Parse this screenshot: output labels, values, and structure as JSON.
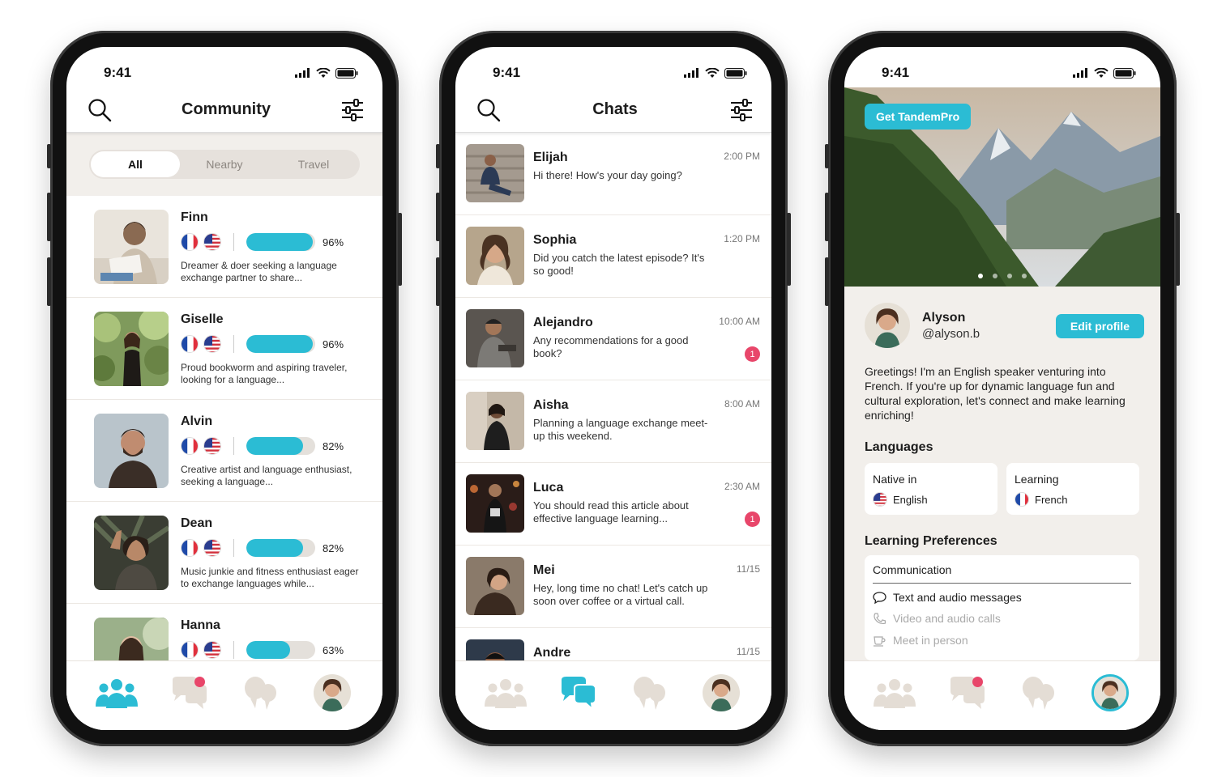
{
  "status": {
    "time": "9:41"
  },
  "community": {
    "title": "Community",
    "segments": [
      "All",
      "Nearby",
      "Travel"
    ],
    "members": [
      {
        "name": "Finn",
        "percent_label": "96%",
        "match": 0.96,
        "bio": "Dreamer & doer seeking a language exchange partner to share...",
        "photo": "man-reading-photo"
      },
      {
        "name": "Giselle",
        "percent_label": "96%",
        "match": 0.96,
        "bio": "Proud bookworm and aspiring traveler, looking for a language...",
        "photo": "woman-forest-photo"
      },
      {
        "name": "Alvin",
        "percent_label": "82%",
        "match": 0.82,
        "bio": "Creative artist and language enthusiast, seeking a language...",
        "photo": "man-beard-photo"
      },
      {
        "name": "Dean",
        "percent_label": "82%",
        "match": 0.82,
        "bio": "Music junkie and fitness enthusiast eager to exchange languages while...",
        "photo": "man-palm-photo"
      },
      {
        "name": "Hanna",
        "percent_label": "63%",
        "match": 0.63,
        "bio": "",
        "photo": "woman-park-photo"
      }
    ]
  },
  "chats": {
    "title": "Chats",
    "threads": [
      {
        "name": "Elijah",
        "time": "2:00 PM",
        "message": "Hi there! How's your day going?",
        "unread": ""
      },
      {
        "name": "Sophia",
        "time": "1:20 PM",
        "message": "Did you catch the latest episode? It's so good!",
        "unread": ""
      },
      {
        "name": "Alejandro",
        "time": "10:00 AM",
        "message": "Any recommendations for a good book?",
        "unread": "1"
      },
      {
        "name": "Aisha",
        "time": "8:00 AM",
        "message": "Planning a language exchange meet-up this weekend.",
        "unread": ""
      },
      {
        "name": "Luca",
        "time": "2:30 AM",
        "message": "You should read this article about effective language learning...",
        "unread": "1"
      },
      {
        "name": "Mei",
        "time": "11/15",
        "message": "Hey, long time no chat! Let's catch up soon over coffee or a virtual call.",
        "unread": ""
      },
      {
        "name": "Andre",
        "time": "11/15",
        "message": "",
        "unread": ""
      }
    ]
  },
  "profile": {
    "pro_button": "Get TandemPro",
    "name": "Alyson",
    "handle": "@alyson.b",
    "edit_button": "Edit profile",
    "bio": "Greetings! I'm an English speaker venturing into French. If you're up for dynamic language fun and cultural exploration, let's connect and make learning enriching!",
    "languages_title": "Languages",
    "native_label": "Native in",
    "native_language": "English",
    "learning_label": "Learning",
    "learning_language": "French",
    "prefs_title": "Learning Preferences",
    "communication_title": "Communication",
    "prefs": [
      {
        "label": "Text and audio messages",
        "active": true,
        "icon": "speech-bubble-icon"
      },
      {
        "label": "Video and audio calls",
        "active": false,
        "icon": "phone-icon"
      },
      {
        "label": "Meet in person",
        "active": false,
        "icon": "coffee-cup-icon"
      }
    ],
    "carousel_pages": 4,
    "carousel_active": 1
  },
  "colors": {
    "accent": "#2bbcd4",
    "badge": "#e8466a",
    "beige": "#f2efeb",
    "inactive_icon": "#e4ddd5"
  }
}
